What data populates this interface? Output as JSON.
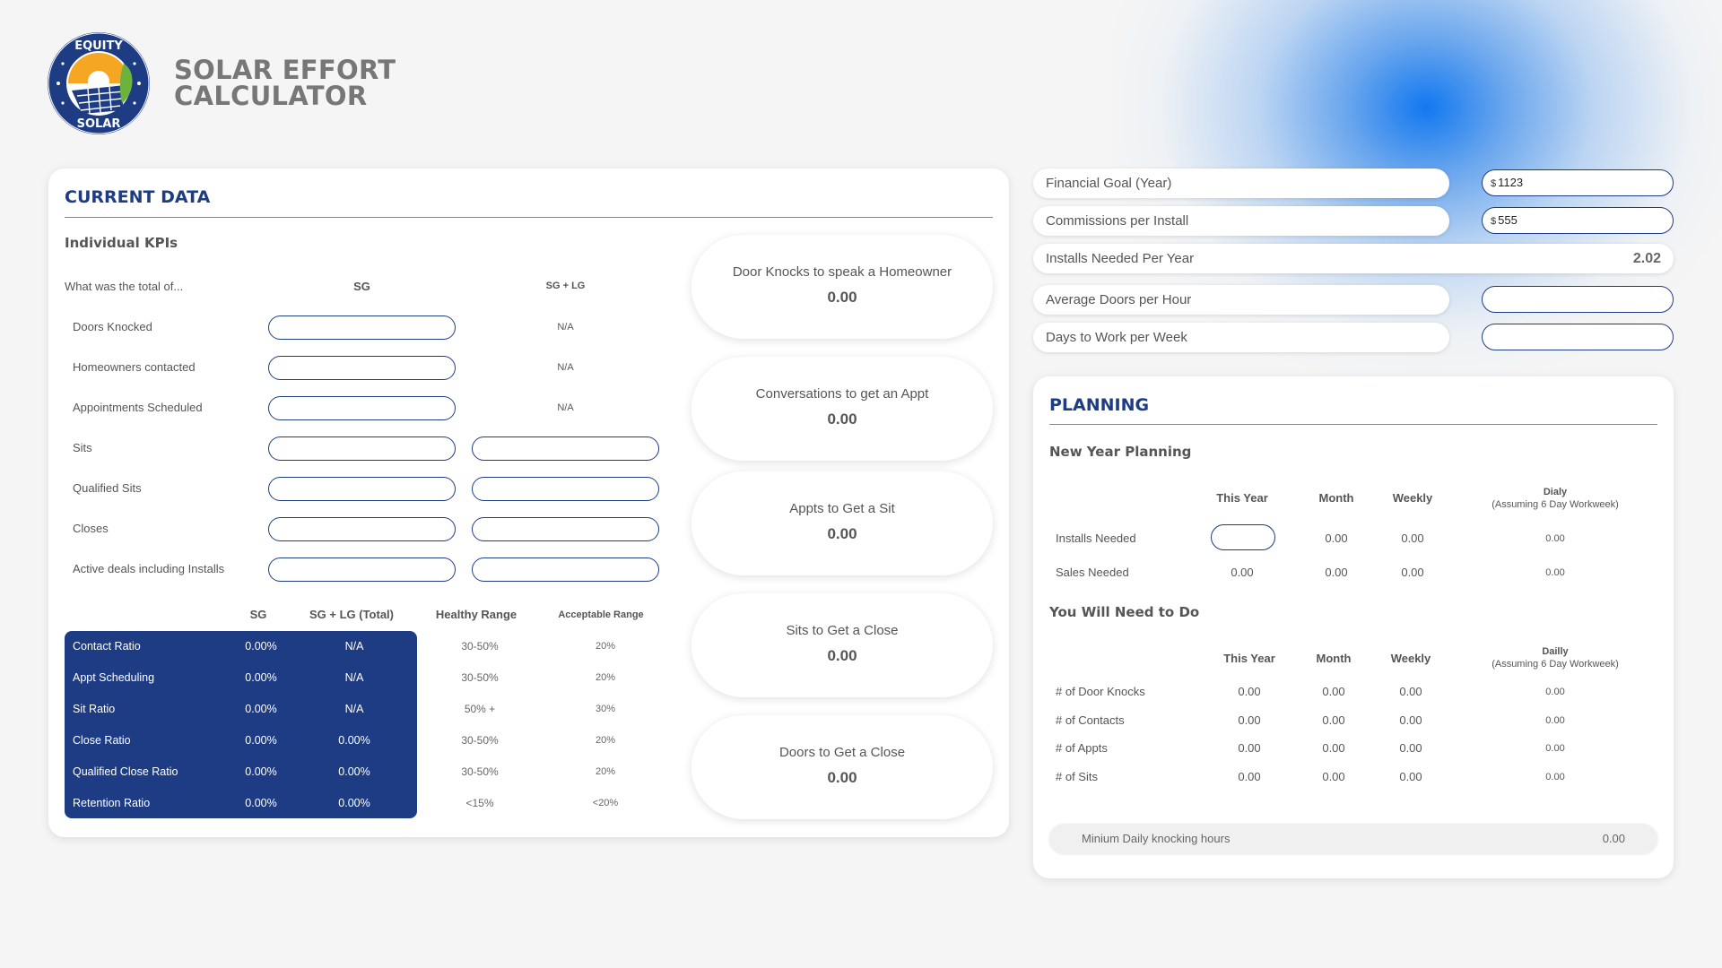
{
  "app": {
    "logo_top_text": "EQUITY",
    "logo_bottom_text": "SOLAR",
    "title_line1": "SOLAR EFFORT",
    "title_line2": "CALCULATOR"
  },
  "colors": {
    "accent": "#1e3c84",
    "glow": "#1278f0",
    "sun": "#f5a623",
    "leaf": "#6bb33d"
  },
  "current_data": {
    "title": "CURRENT DATA",
    "kpi_heading": "Individual KPIs",
    "question": "What was the total of...",
    "col_sg": "SG",
    "col_sg_lg": "SG + LG",
    "rows": [
      {
        "label": "Doors Knocked",
        "sg": "",
        "sg_lg": "N/A"
      },
      {
        "label": "Homeowners contacted",
        "sg": "",
        "sg_lg": "N/A"
      },
      {
        "label": "Appointments Scheduled",
        "sg": "",
        "sg_lg": "N/A"
      },
      {
        "label": "Sits",
        "sg": "",
        "sg_lg": ""
      },
      {
        "label": "Qualified Sits",
        "sg": "",
        "sg_lg": ""
      },
      {
        "label": "Closes",
        "sg": "",
        "sg_lg": ""
      },
      {
        "label": "Active deals including Installs",
        "sg": "",
        "sg_lg": ""
      }
    ],
    "ratio_headers": {
      "sg": "SG",
      "sg_lg_total": "SG + LG (Total)",
      "healthy": "Healthy Range",
      "acceptable": "Acceptable Range"
    },
    "ratios": [
      {
        "label": "Contact Ratio",
        "sg": "0.00%",
        "total": "N/A",
        "healthy": "30-50%",
        "acceptable": "20%"
      },
      {
        "label": "Appt Scheduling",
        "sg": "0.00%",
        "total": "N/A",
        "healthy": "30-50%",
        "acceptable": "20%"
      },
      {
        "label": "Sit Ratio",
        "sg": "0.00%",
        "total": "N/A",
        "healthy": "50% +",
        "acceptable": "30%"
      },
      {
        "label": "Close Ratio",
        "sg": "0.00%",
        "total": "0.00%",
        "healthy": "30-50%",
        "acceptable": "20%"
      },
      {
        "label": "Qualified Close Ratio",
        "sg": "0.00%",
        "total": "0.00%",
        "healthy": "30-50%",
        "acceptable": "20%"
      },
      {
        "label": "Retention Ratio",
        "sg": "0.00%",
        "total": "0.00%",
        "healthy": "<15%",
        "acceptable": "<20%"
      }
    ],
    "metrics": [
      {
        "label": "Door Knocks to speak a Homeowner",
        "value": "0.00"
      },
      {
        "label": "Conversations to get an Appt",
        "value": "0.00"
      },
      {
        "label": "Appts to Get a Sit",
        "value": "0.00"
      },
      {
        "label": "Sits to Get a Close",
        "value": "0.00"
      },
      {
        "label": "Doors to Get a Close",
        "value": "0.00"
      }
    ]
  },
  "goals": {
    "financial_goal_label": "Financial Goal (Year)",
    "financial_goal_currency": "$",
    "financial_goal_value": "1123",
    "commission_label": "Commissions per Install",
    "commission_currency": "$",
    "commission_value": "555",
    "installs_needed_label": "Installs Needed Per Year",
    "installs_needed_value": "2.02",
    "avg_doors_label": "Average Doors per Hour",
    "avg_doors_value": "",
    "days_per_week_label": "Days to Work per Week",
    "days_per_week_value": ""
  },
  "planning": {
    "title": "PLANNING",
    "new_year_heading": "New Year Planning",
    "headers": {
      "this_year": "This Year",
      "month": "Month",
      "weekly": "Weekly",
      "daily": "Dialy",
      "daily_note": "(Assuming 6 Day Workweek)"
    },
    "installs_row": {
      "label": "Installs Needed",
      "this_year": "",
      "month": "0.00",
      "weekly": "0.00",
      "daily": "0.00"
    },
    "sales_row": {
      "label": "Sales Needed",
      "this_year": "0.00",
      "month": "0.00",
      "weekly": "0.00",
      "daily": "0.00"
    },
    "need_heading": "You Will Need to Do",
    "need_headers": {
      "this_year": "This Year",
      "month": "Month",
      "weekly": "Weekly",
      "daily": "Dailly",
      "daily_note": "(Assuming 6 Day Workweek)"
    },
    "need_rows": [
      {
        "label": "# of Door Knocks",
        "this_year": "0.00",
        "month": "0.00",
        "weekly": "0.00",
        "daily": "0.00"
      },
      {
        "label": "# of Contacts",
        "this_year": "0.00",
        "month": "0.00",
        "weekly": "0.00",
        "daily": "0.00"
      },
      {
        "label": "# of Appts",
        "this_year": "0.00",
        "month": "0.00",
        "weekly": "0.00",
        "daily": "0.00"
      },
      {
        "label": "# of Sits",
        "this_year": "0.00",
        "month": "0.00",
        "weekly": "0.00",
        "daily": "0.00"
      }
    ],
    "min_hours_label": "Minium Daily knocking hours",
    "min_hours_value": "0.00"
  }
}
